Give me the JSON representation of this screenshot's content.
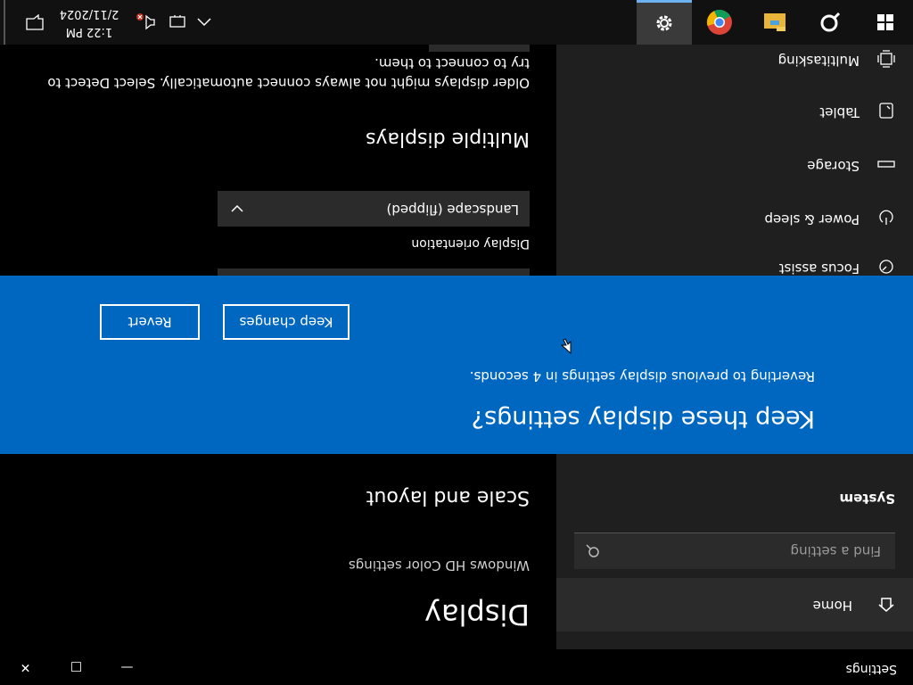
{
  "window": {
    "title": "Settings",
    "minimize_label": "—",
    "maximize_label": "□",
    "close_label": "✕"
  },
  "sidebar": {
    "home_label": "Home",
    "search_placeholder": "Find a setting",
    "section": "System",
    "items": [
      {
        "label": "Focus assist",
        "icon": "focus-assist-icon"
      },
      {
        "label": "Power & sleep",
        "icon": "power-icon"
      },
      {
        "label": "Storage",
        "icon": "storage-icon"
      },
      {
        "label": "Tablet",
        "icon": "tablet-icon"
      },
      {
        "label": "Multitasking",
        "icon": "multitasking-icon"
      }
    ]
  },
  "content": {
    "title": "Display",
    "hd_color_link": "Windows HD Color settings",
    "scale_heading": "Scale and layout",
    "orientation_label": "Display orientation",
    "orientation_value": "Landscape (flipped)",
    "multiple_heading": "Multiple displays",
    "multiple_desc": "Older displays might not always connect automatically. Select Detect to try to connect to them."
  },
  "banner": {
    "title": "Keep these display settings?",
    "message": "Reverting to previous display settings in  4 seconds.",
    "keep_label": "Keep changes",
    "revert_label": "Revert"
  },
  "taskbar": {
    "apps": [
      "windows-start-icon",
      "cortana-search-icon",
      "file-explorer-icon",
      "chrome-icon",
      "settings-icon"
    ],
    "time": "1:22 PM",
    "date": "2/11/2024"
  },
  "colors": {
    "banner": "#0067c0",
    "sidebar": "#1f1f1f",
    "accent_line": "#6cb2f0"
  }
}
